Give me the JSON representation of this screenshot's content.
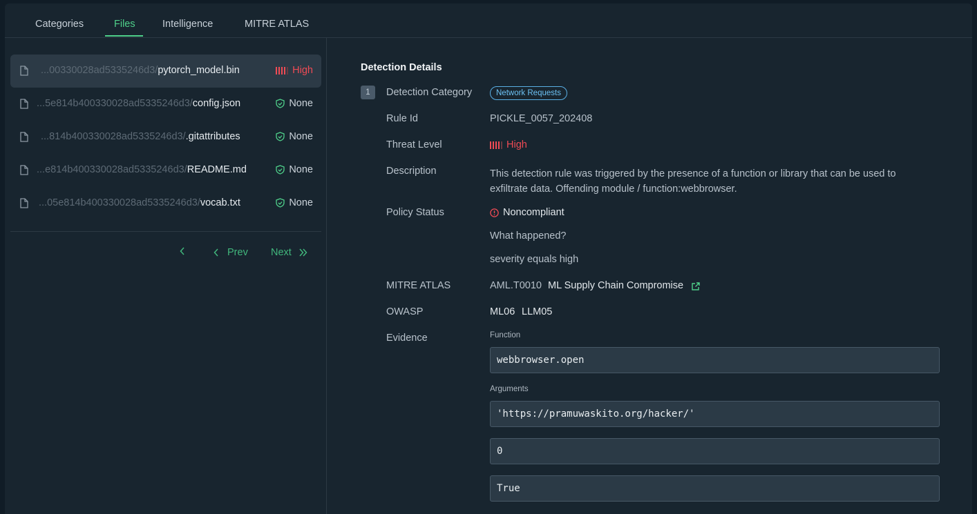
{
  "tabs": [
    {
      "label": "Categories",
      "active": false
    },
    {
      "label": "Files",
      "active": true
    },
    {
      "label": "Intelligence",
      "active": false
    },
    {
      "label": "MITRE ATLAS",
      "active": false
    }
  ],
  "files": [
    {
      "prefix": "...00330028ad5335246d3/",
      "name": "pytorch_model.bin",
      "status": "High",
      "level": "high",
      "selected": true
    },
    {
      "prefix": "...5e814b400330028ad5335246d3/",
      "name": "config.json",
      "status": "None",
      "level": "none",
      "selected": false
    },
    {
      "prefix": "...814b400330028ad5335246d3/",
      "name": ".gitattributes",
      "status": "None",
      "level": "none",
      "selected": false
    },
    {
      "prefix": "...e814b400330028ad5335246d3/",
      "name": "README.md",
      "status": "None",
      "level": "none",
      "selected": false
    },
    {
      "prefix": "...05e814b400330028ad5335246d3/",
      "name": "vocab.txt",
      "status": "None",
      "level": "none",
      "selected": false
    }
  ],
  "pager": {
    "prev": "Prev",
    "next": "Next"
  },
  "details": {
    "title": "Detection Details",
    "index": "1",
    "category_label": "Detection Category",
    "category_value": "Network Requests",
    "rule_label": "Rule Id",
    "rule_value": "PICKLE_0057_202408",
    "threat_label": "Threat Level",
    "threat_value": "High",
    "description_label": "Description",
    "description_value": "This detection rule was triggered by the presence of a function or library that can be used to exfiltrate data. Offending module / function:webbrowser.",
    "policy_label": "Policy Status",
    "policy_value": "Noncompliant",
    "what_happened": "What happened?",
    "severity_note": "severity equals high",
    "mitre_label": "MITRE ATLAS",
    "mitre_id": "AML.T0010",
    "mitre_name": "ML Supply Chain Compromise",
    "owasp_label": "OWASP",
    "owasp_values": [
      "ML06",
      "LLM05"
    ],
    "evidence_label": "Evidence",
    "function_label": "Function",
    "function_value": "webbrowser.open",
    "arguments_label": "Arguments",
    "arguments": [
      "'https://pramuwaskito.org/hacker/'",
      "0",
      "True"
    ]
  },
  "colors": {
    "accent": "#4fd08a",
    "high": "#f04b55",
    "link": "#6cc0f2",
    "background": "#18252f"
  }
}
